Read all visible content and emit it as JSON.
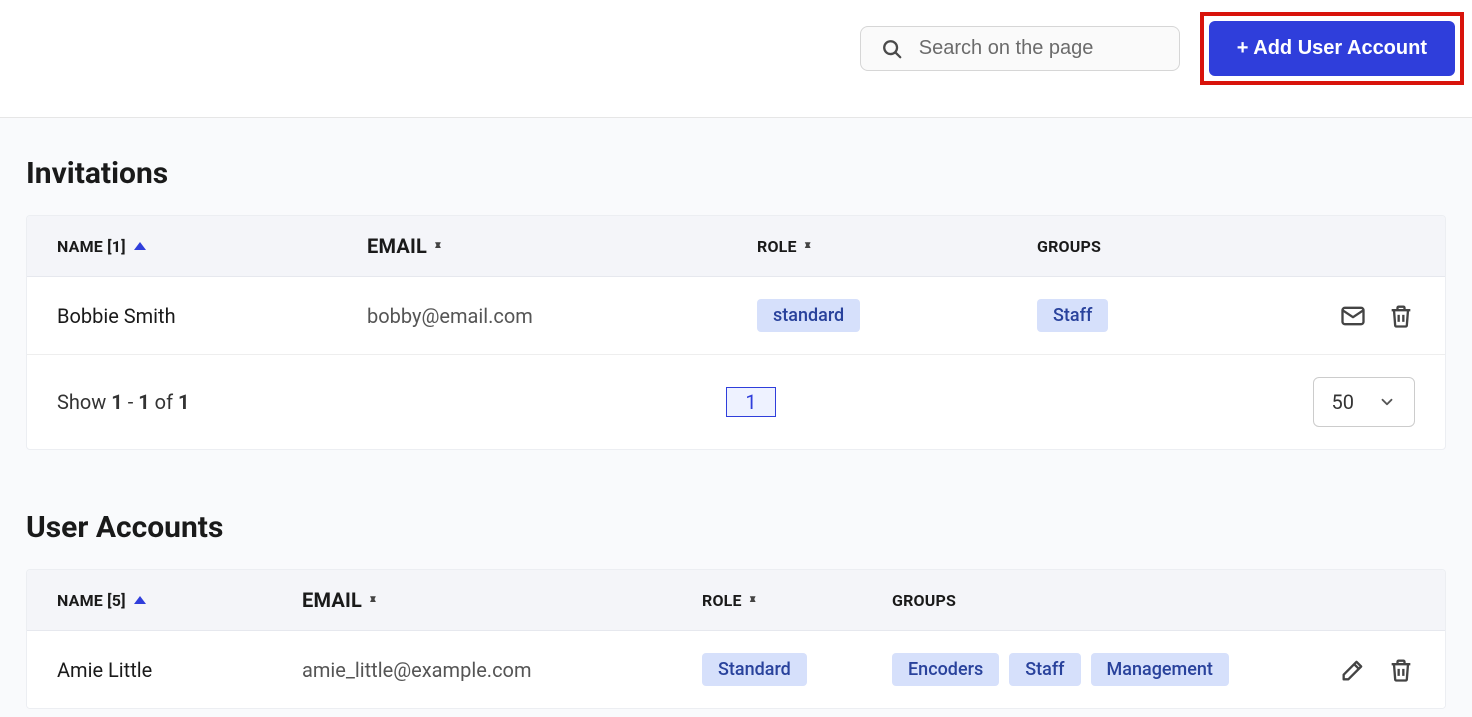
{
  "toolbar": {
    "search_placeholder": "Search on the page",
    "add_user_label": "+ Add User Account"
  },
  "invitations": {
    "title": "Invitations",
    "columns": {
      "name": "NAME [1]",
      "email": "EMAIL",
      "role": "ROLE",
      "groups": "GROUPS"
    },
    "rows": [
      {
        "name": "Bobbie Smith",
        "email": "bobby@email.com",
        "role": "standard",
        "groups": [
          "Staff"
        ]
      }
    ],
    "pagination": {
      "show_prefix": "Show ",
      "from": "1",
      "dash": " - ",
      "to": "1",
      "of_word": " of ",
      "total": "1",
      "current_page": "1",
      "page_size": "50"
    }
  },
  "accounts": {
    "title": "User Accounts",
    "columns": {
      "name": "NAME [5]",
      "email": "EMAIL",
      "role": "ROLE",
      "groups": "GROUPS"
    },
    "rows": [
      {
        "name": "Amie Little",
        "email": "amie_little@example.com",
        "role": "Standard",
        "groups": [
          "Encoders",
          "Staff",
          "Management"
        ]
      }
    ]
  }
}
